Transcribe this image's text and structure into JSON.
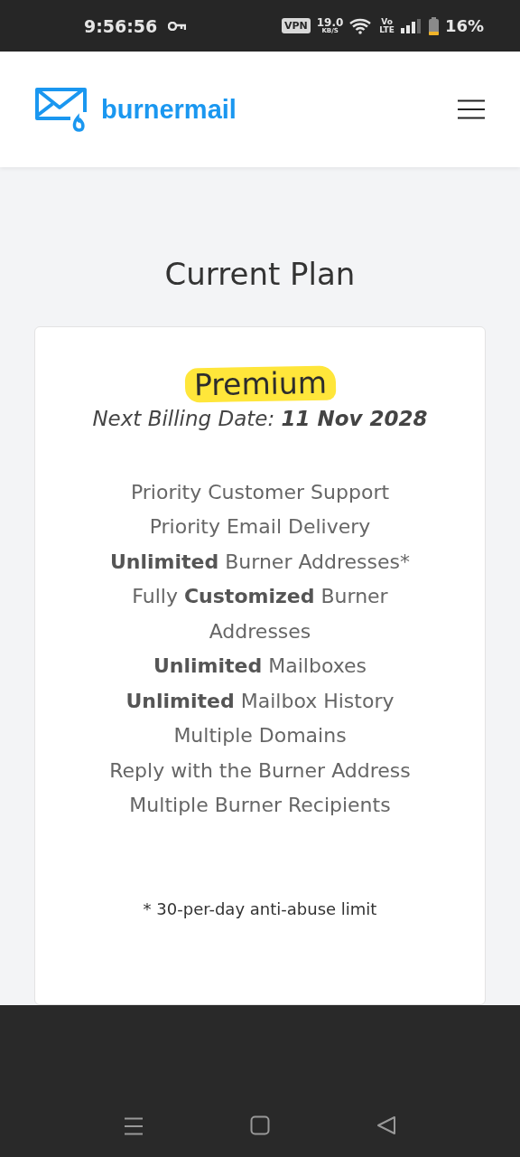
{
  "status_bar": {
    "time": "9:56:56",
    "vpn": "VPN",
    "speed": "19.0",
    "speed_unit": "KB/S",
    "volte_top": "Vo",
    "volte_bottom": "LTE",
    "battery": "16%"
  },
  "header": {
    "brand": "burnermail"
  },
  "section_title": "Current Plan",
  "plan": {
    "name": "Premium",
    "billing": "*Next Billing Date:* **11 Nov 2028**",
    "features": [
      "Priority Customer Support",
      "Priority Email Delivery",
      "**Unlimited** Burner Addresses*",
      "Fully **Customized** Burner Addresses",
      "**Unlimited** Mailboxes",
      "**Unlimited** Mailbox History",
      "Multiple Domains",
      "Reply with the Burner Address",
      "Multiple Burner Recipients"
    ],
    "footnote": "* 30-per-day anti-abuse limit"
  }
}
